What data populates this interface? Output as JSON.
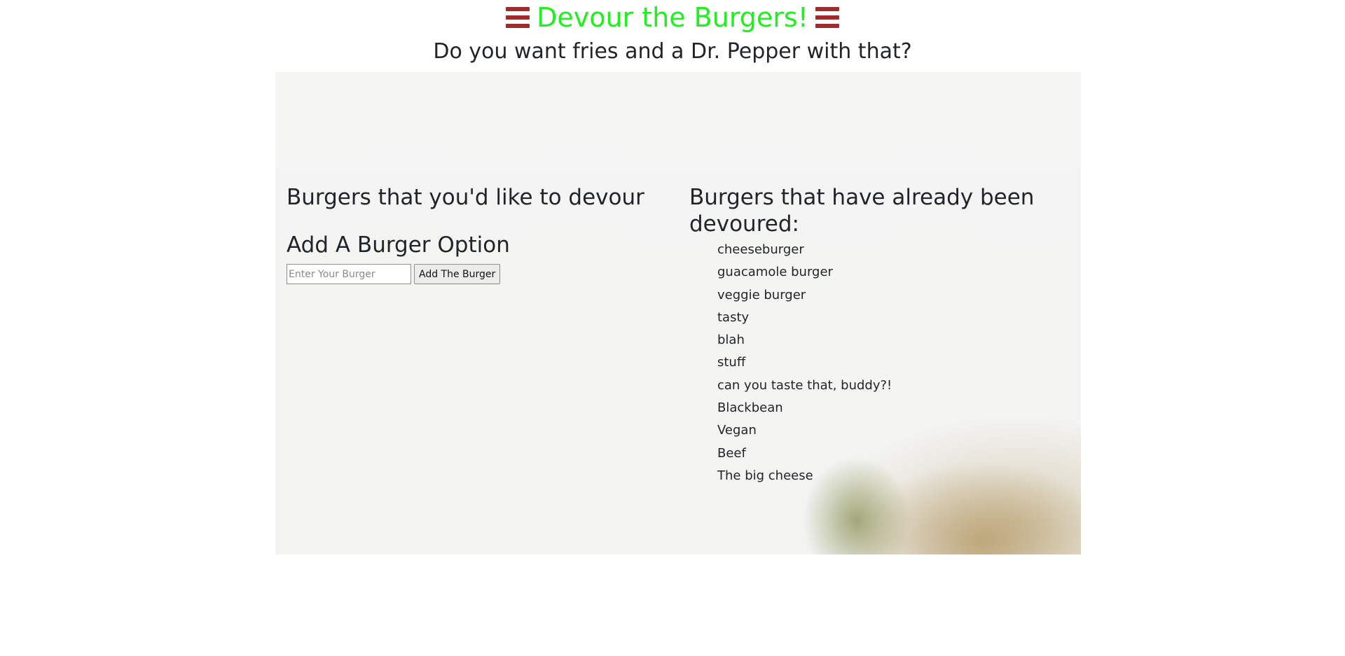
{
  "header": {
    "title": "Devour the Burgers!",
    "subtitle": "Do you want fries and a Dr. Pepper with that?",
    "icon_left": "hamburger-menu-icon",
    "icon_right": "hamburger-menu-icon"
  },
  "left_column": {
    "heading": "Burgers that you'd like to devour",
    "form": {
      "heading": "Add A Burger Option",
      "input_placeholder": "Enter Your Burger",
      "input_value": "",
      "button_label": "Add The Burger"
    }
  },
  "right_column": {
    "heading": "Burgers that have already been devoured:",
    "items": [
      "cheeseburger",
      "guacamole burger",
      "veggie burger",
      "tasty",
      "blah",
      "stuff",
      "can you taste that, buddy?!",
      "Blackbean",
      "Vegan",
      "Beef",
      "The big cheese"
    ]
  },
  "colors": {
    "title": "#22ee22",
    "icon": "#a52a2a",
    "text": "#212529"
  }
}
